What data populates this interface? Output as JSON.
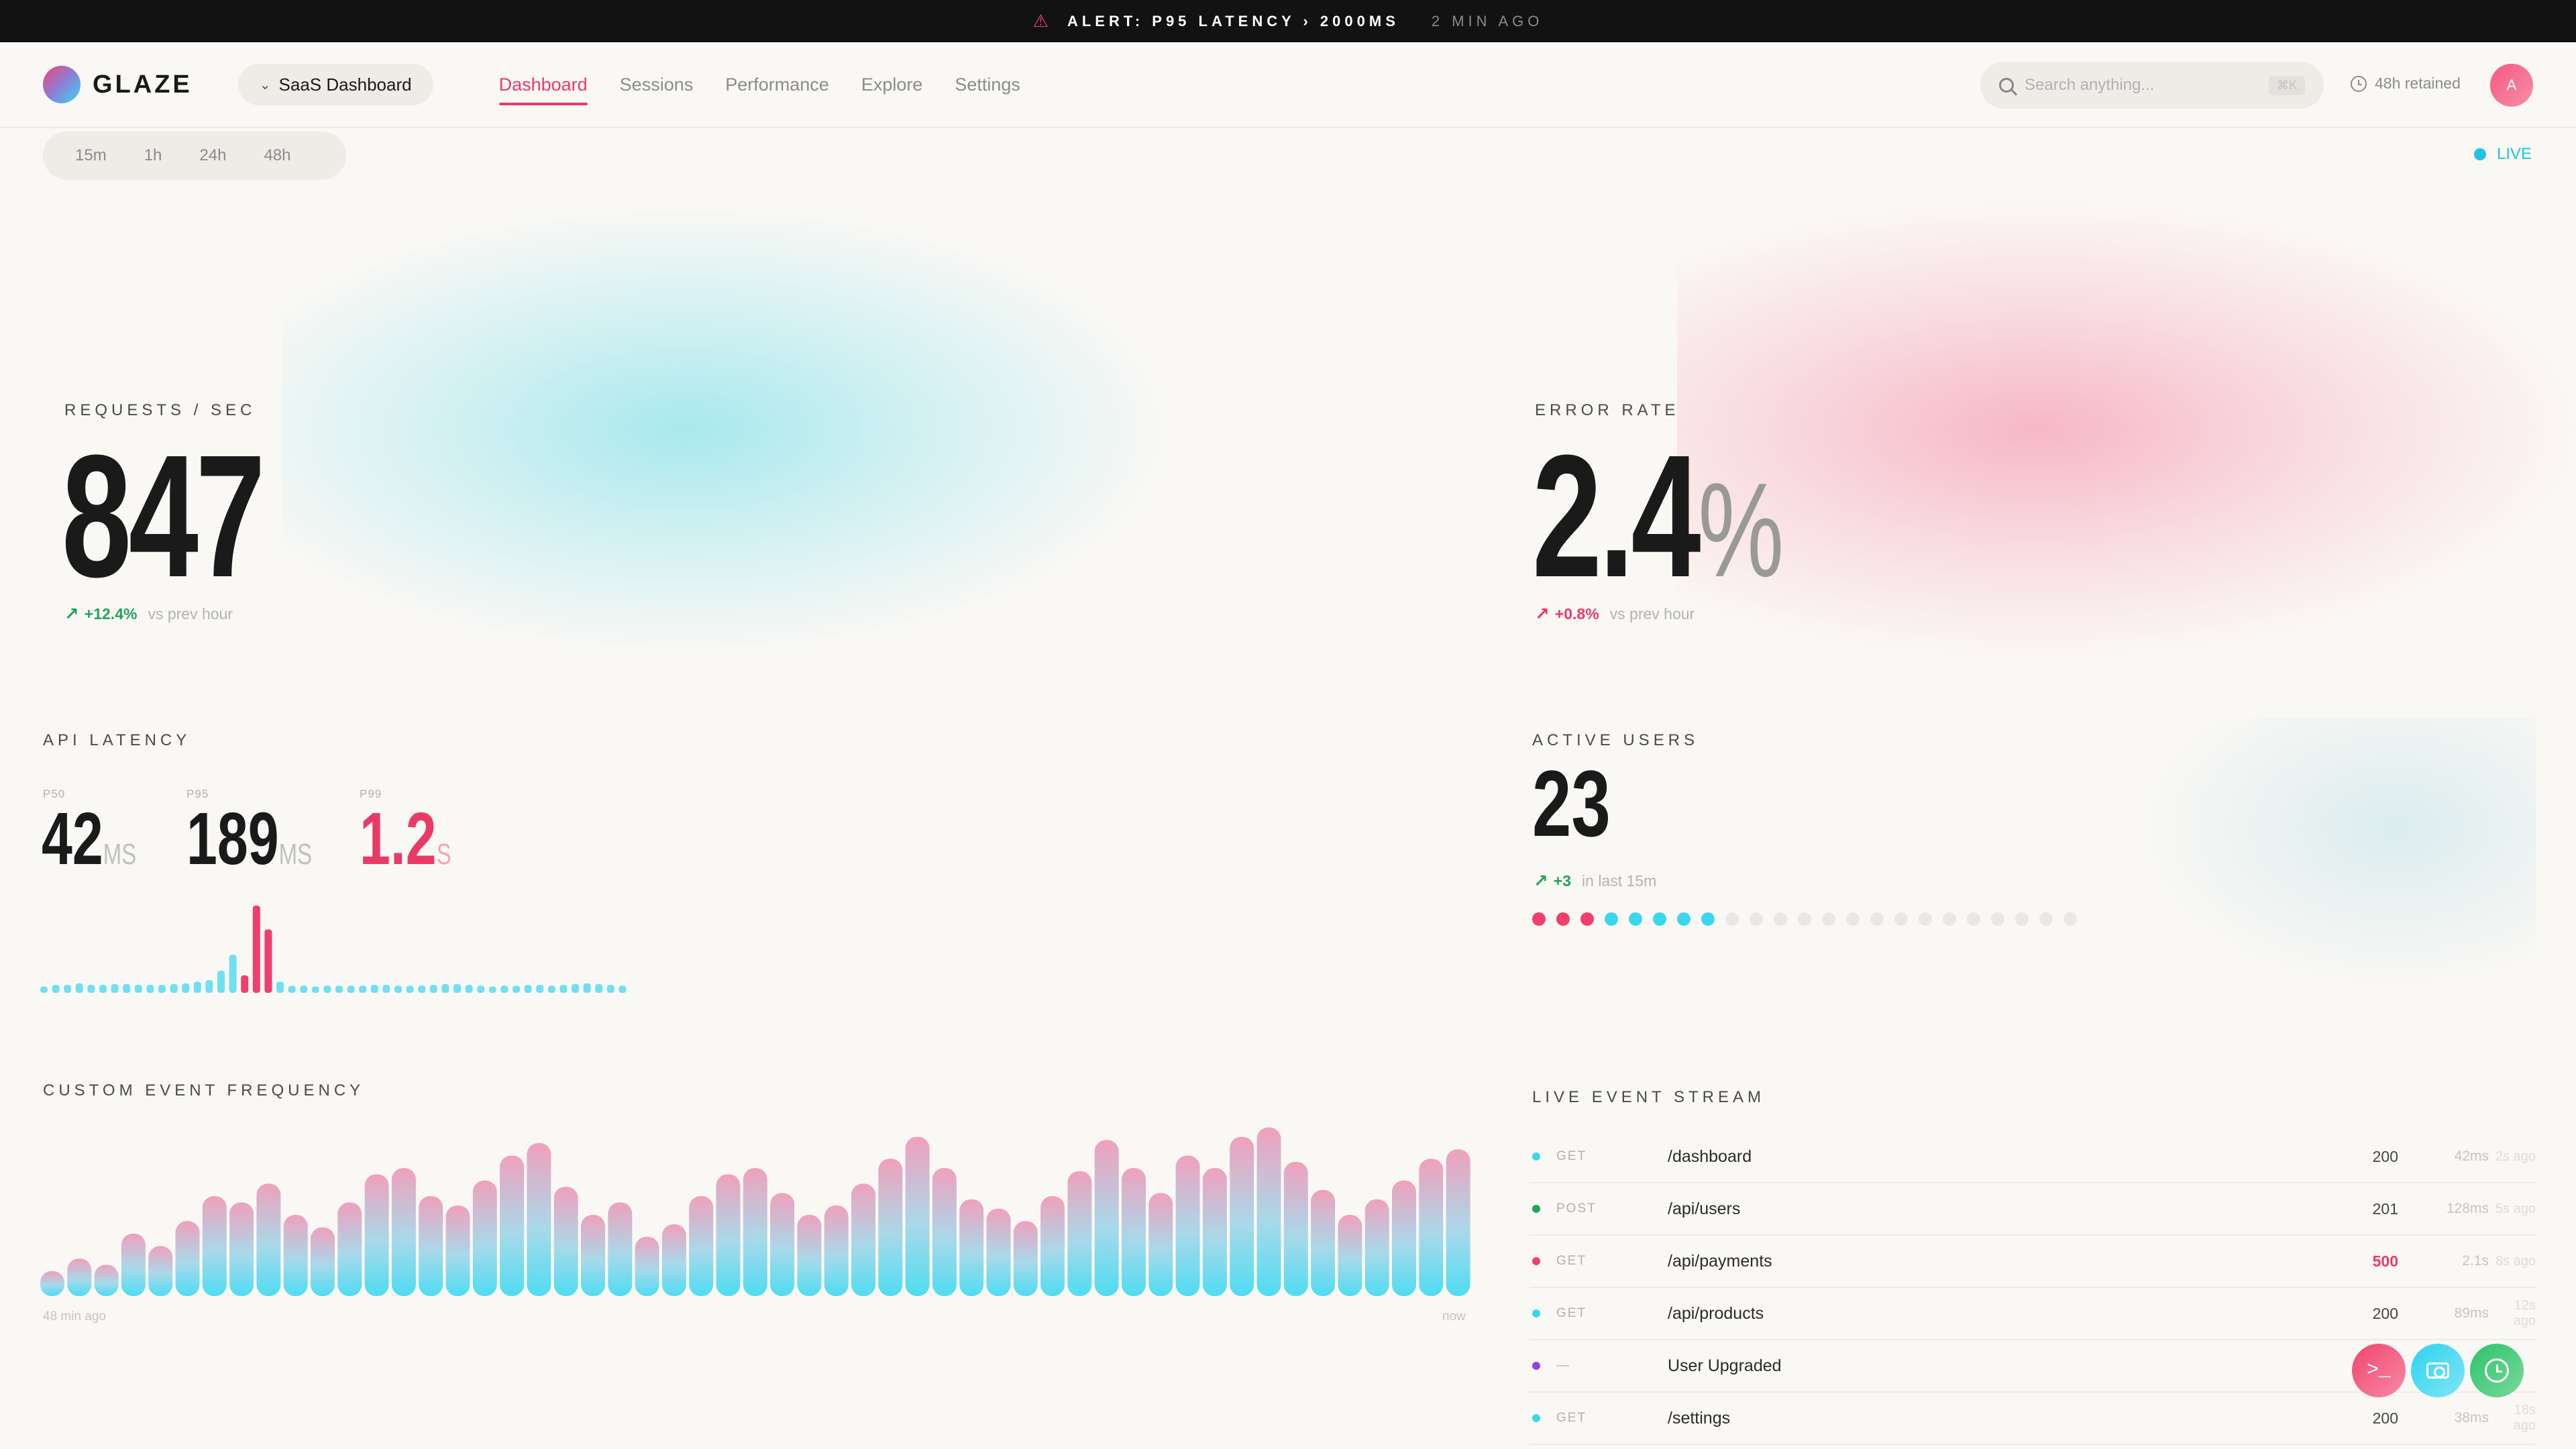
{
  "alert": {
    "text": "ALERT: P95 LATENCY › 2000MS",
    "ago": "2 MIN AGO"
  },
  "header": {
    "logo": "GLAZE",
    "dashboard_select": "SaaS Dashboard",
    "nav": [
      "Dashboard",
      "Sessions",
      "Performance",
      "Explore",
      "Settings"
    ],
    "active_nav": "Dashboard",
    "search_placeholder": "Search anything...",
    "search_shortcut": "⌘K",
    "retained": "48h retained",
    "avatar_initial": "A"
  },
  "time_range": [
    "15m",
    "1h",
    "24h",
    "48h"
  ],
  "live_label": "LIVE",
  "requests": {
    "label": "REQUESTS / SEC",
    "value": "847",
    "delta": "+12.4%",
    "delta_sub": "vs prev hour"
  },
  "error_rate": {
    "label": "ERROR RATE",
    "value": "2.4",
    "unit": "%",
    "delta": "+0.8%",
    "delta_sub": "vs prev hour"
  },
  "latency": {
    "label": "API LATENCY",
    "p50": {
      "label": "P50",
      "value": "42",
      "unit": "MS"
    },
    "p95": {
      "label": "P95",
      "value": "189",
      "unit": "MS"
    },
    "p99": {
      "label": "P99",
      "value": "1.2",
      "unit": "S"
    }
  },
  "active_users": {
    "label": "ACTIVE USERS",
    "value": "23",
    "delta": "+3",
    "delta_sub": "in last 15m",
    "dots_red": 3,
    "dots_cyan": 5,
    "dots_total": 23
  },
  "custom_events": {
    "label": "CUSTOM EVENT FREQUENCY",
    "x_start": "48 min ago",
    "x_end": "now"
  },
  "event_stream": {
    "label": "LIVE EVENT STREAM",
    "rows": [
      {
        "method": "GET",
        "path": "/dashboard",
        "code": "200",
        "dur": "42ms",
        "ago": "2s ago",
        "color": "#3dd6f0"
      },
      {
        "method": "POST",
        "path": "/api/users",
        "code": "201",
        "dur": "128ms",
        "ago": "5s ago",
        "color": "#22a35b"
      },
      {
        "method": "GET",
        "path": "/api/payments",
        "code": "500",
        "dur": "2.1s",
        "ago": "8s ago",
        "color": "#ef3f6c"
      },
      {
        "method": "GET",
        "path": "/api/products",
        "code": "200",
        "dur": "89ms",
        "ago": "12s ago",
        "color": "#3dd6f0"
      },
      {
        "method": "—",
        "path": "User Upgraded",
        "code": "",
        "dur": "",
        "ago": "",
        "color": "#9b3de0"
      },
      {
        "method": "GET",
        "path": "/settings",
        "code": "200",
        "dur": "38ms",
        "ago": "18s ago",
        "color": "#3dd6f0"
      }
    ]
  },
  "chart_data": [
    {
      "type": "bar",
      "title": "API LATENCY",
      "values": [
        8,
        10,
        10,
        12,
        10,
        10,
        11,
        11,
        10,
        10,
        10,
        11,
        12,
        14,
        16,
        28,
        48,
        22,
        110,
        80,
        14,
        9,
        9,
        8,
        9,
        9,
        9,
        9,
        10,
        10,
        9,
        9,
        9,
        10,
        11,
        11,
        10,
        9,
        8,
        9,
        9,
        10,
        10,
        9,
        10,
        11,
        12,
        11,
        10,
        9
      ],
      "highlight_indices": [
        17,
        18,
        19
      ],
      "colors": {
        "normal": "#6ee0f2",
        "highlight": "#ef3f6c"
      }
    },
    {
      "type": "bar",
      "title": "CUSTOM EVENT FREQUENCY",
      "values": [
        16,
        24,
        20,
        40,
        32,
        48,
        64,
        60,
        72,
        52,
        44,
        60,
        78,
        82,
        64,
        58,
        74,
        90,
        98,
        70,
        52,
        60,
        38,
        46,
        64,
        78,
        82,
        66,
        52,
        58,
        72,
        88,
        102,
        82,
        62,
        56,
        48,
        64,
        80,
        100,
        82,
        66,
        90,
        82,
        102,
        108,
        86,
        68,
        52,
        62,
        74,
        88,
        94
      ],
      "xlabel_start": "48 min ago",
      "xlabel_end": "now"
    }
  ]
}
